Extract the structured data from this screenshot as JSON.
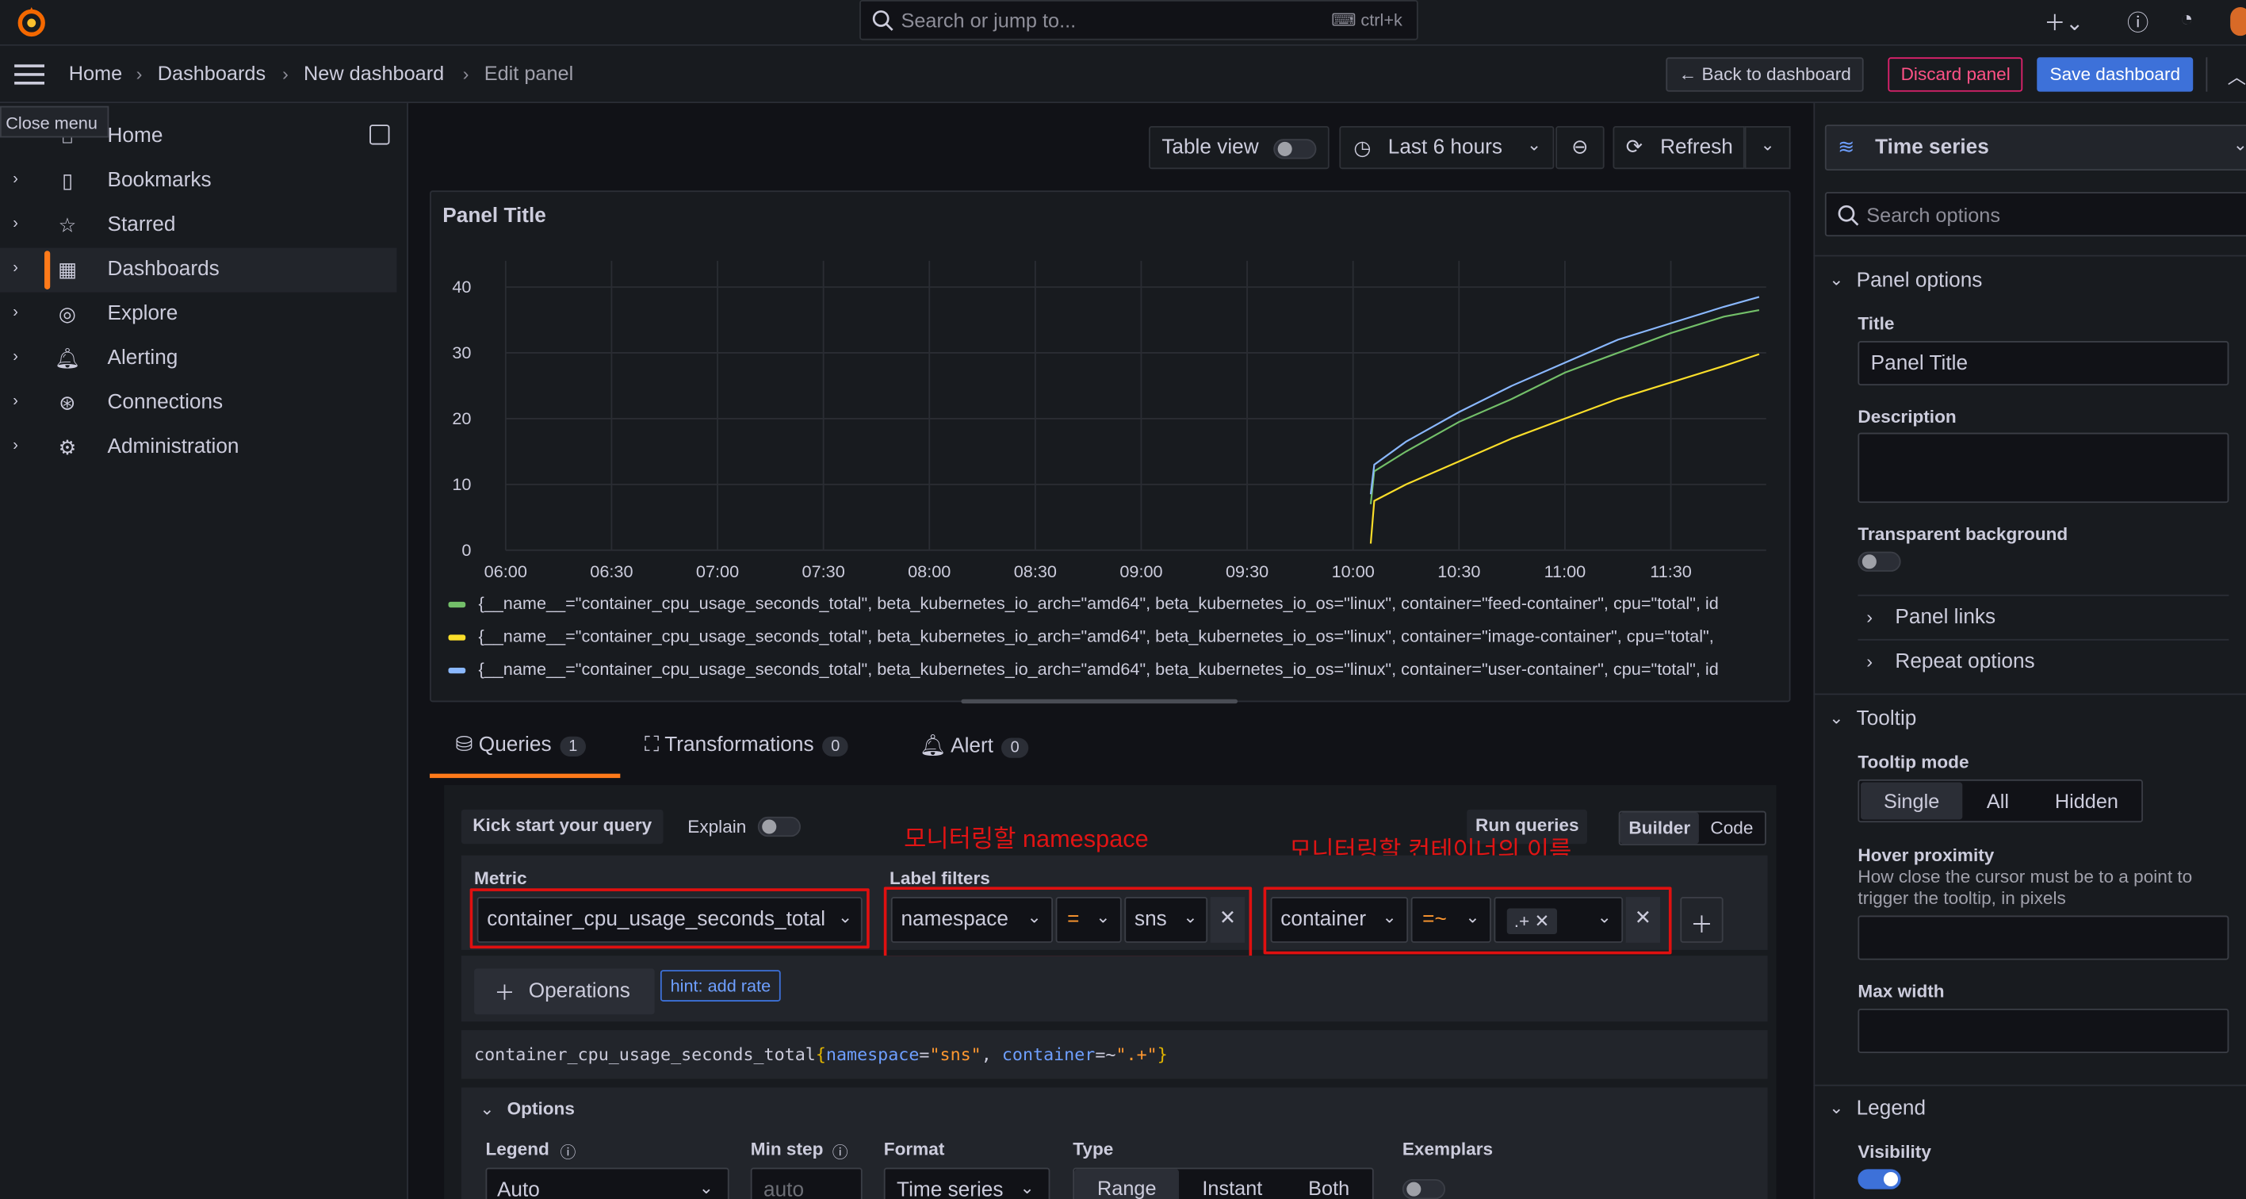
{
  "search": {
    "placeholder": "Search or jump to...",
    "shortcut": "ctrl+k"
  },
  "breadcrumb": [
    "Home",
    "Dashboards",
    "New dashboard",
    "Edit panel"
  ],
  "header": {
    "back": "Back to dashboard",
    "discard": "Discard panel",
    "save": "Save dashboard"
  },
  "tooltip": "Close menu",
  "nav": [
    "Home",
    "Bookmarks",
    "Starred",
    "Dashboards",
    "Explore",
    "Alerting",
    "Connections",
    "Administration"
  ],
  "toolbar": {
    "table_view": "Table view",
    "time_range": "Last 6 hours",
    "refresh": "Refresh"
  },
  "panel": {
    "title": "Panel Title"
  },
  "chart_data": {
    "type": "line",
    "x_ticks": [
      "06:00",
      "06:30",
      "07:00",
      "07:30",
      "08:00",
      "08:30",
      "09:00",
      "09:30",
      "10:00",
      "10:30",
      "11:00",
      "11:30"
    ],
    "y_ticks": [
      0,
      10,
      20,
      30,
      40
    ],
    "ylim": [
      0,
      44
    ],
    "x": [
      "10:05",
      "10:06",
      "10:15",
      "10:30",
      "10:45",
      "11:00",
      "11:15",
      "11:30",
      "11:45",
      "11:55"
    ],
    "series": [
      {
        "name": "{__name__=\"container_cpu_usage_seconds_total\", beta_kubernetes_io_arch=\"amd64\", beta_kubernetes_io_os=\"linux\", container=\"feed-container\", cpu=\"total\", id",
        "color": "#73bf69",
        "values": [
          7,
          12,
          15,
          19.5,
          23,
          27,
          30,
          33,
          35.5,
          36.5
        ]
      },
      {
        "name": "{__name__=\"container_cpu_usage_seconds_total\", beta_kubernetes_io_arch=\"amd64\", beta_kubernetes_io_os=\"linux\", container=\"image-container\", cpu=\"total\",",
        "color": "#fade2a",
        "values": [
          1,
          7.5,
          10,
          13.5,
          17,
          20,
          23,
          25.5,
          28,
          29.8
        ]
      },
      {
        "name": "{__name__=\"container_cpu_usage_seconds_total\", beta_kubernetes_io_arch=\"amd64\", beta_kubernetes_io_os=\"linux\", container=\"user-container\", cpu=\"total\", id",
        "color": "#8ab8ff",
        "values": [
          8.5,
          13,
          16.5,
          21,
          25,
          28.5,
          32,
          34.5,
          37,
          38.5
        ]
      }
    ]
  },
  "tabs": [
    {
      "label": "Queries",
      "count": "1"
    },
    {
      "label": "Transformations",
      "count": "0"
    },
    {
      "label": "Alert",
      "count": "0"
    }
  ],
  "query": {
    "kick_start": "Kick start your query",
    "explain": "Explain",
    "run": "Run queries",
    "builder": "Builder",
    "code": "Code",
    "metric_label": "Metric",
    "metric": "container_cpu_usage_seconds_total",
    "label_filters": "Label filters",
    "filter1": {
      "key": "namespace",
      "op": "=",
      "value": "sns"
    },
    "filter2": {
      "key": "container",
      "op": "=~",
      "value": ".+"
    },
    "operations": "Operations",
    "hint": "hint: add rate",
    "code_metric": "container_cpu_usage_seconds_total",
    "code_open": "{",
    "code_k1": "namespace",
    "code_eq1": "=",
    "code_v1": "\"sns\"",
    "code_comma": ", ",
    "code_k2": "container",
    "code_eq2": "=~",
    "code_v2": "\".+\"",
    "code_close": "}",
    "options": "Options",
    "legend_label": "Legend",
    "legend_value": "Auto",
    "minstep_label": "Min step",
    "minstep_placeholder": "auto",
    "format_label": "Format",
    "format_value": "Time series",
    "type_label": "Type",
    "type_opts": [
      "Range",
      "Instant",
      "Both"
    ],
    "exemplars_label": "Exemplars"
  },
  "annotations": {
    "namespace": "모니터링할 namespace",
    "container": "모니터링할 컨테이너의 이름"
  },
  "right": {
    "viz": "Time series",
    "search_placeholder": "Search options",
    "panel_options": "Panel options",
    "title_label": "Title",
    "title_value": "Panel Title",
    "description_label": "Description",
    "transparent": "Transparent background",
    "panel_links": "Panel links",
    "repeat": "Repeat options",
    "tooltip_section": "Tooltip",
    "tooltip_mode": "Tooltip mode",
    "tooltip_modes": [
      "Single",
      "All",
      "Hidden"
    ],
    "hover_label": "Hover proximity",
    "hover_desc": "How close the cursor must be to a point to trigger the tooltip, in pixels",
    "max_width": "Max width",
    "legend_section": "Legend",
    "visibility": "Visibility"
  }
}
